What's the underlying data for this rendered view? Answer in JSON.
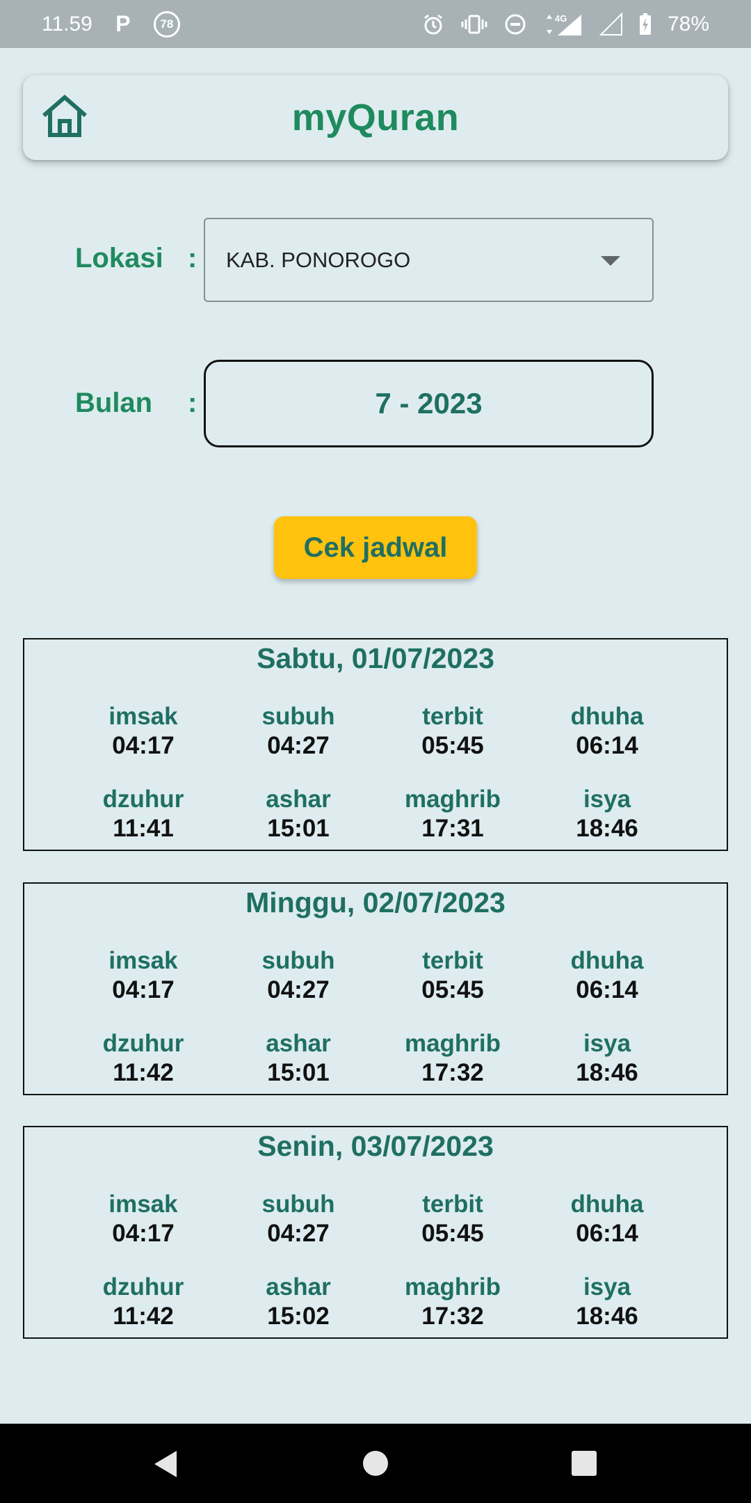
{
  "status_bar": {
    "time": "11.59",
    "notif_p": "P",
    "notif_count": "78",
    "battery": "78%",
    "network": "4G"
  },
  "app": {
    "title": "myQuran"
  },
  "form": {
    "location_label": "Lokasi",
    "colon": ":",
    "location_value": "KAB. PONOROGO",
    "month_label": "Bulan",
    "month_value": "7 - 2023",
    "check_button": "Cek jadwal"
  },
  "schedule": [
    {
      "date": "Sabtu, 01/07/2023",
      "times": [
        {
          "name": "imsak",
          "time": "04:17"
        },
        {
          "name": "subuh",
          "time": "04:27"
        },
        {
          "name": "terbit",
          "time": "05:45"
        },
        {
          "name": "dhuha",
          "time": "06:14"
        },
        {
          "name": "dzuhur",
          "time": "11:41"
        },
        {
          "name": "ashar",
          "time": "15:01"
        },
        {
          "name": "maghrib",
          "time": "17:31"
        },
        {
          "name": "isya",
          "time": "18:46"
        }
      ]
    },
    {
      "date": "Minggu, 02/07/2023",
      "times": [
        {
          "name": "imsak",
          "time": "04:17"
        },
        {
          "name": "subuh",
          "time": "04:27"
        },
        {
          "name": "terbit",
          "time": "05:45"
        },
        {
          "name": "dhuha",
          "time": "06:14"
        },
        {
          "name": "dzuhur",
          "time": "11:42"
        },
        {
          "name": "ashar",
          "time": "15:01"
        },
        {
          "name": "maghrib",
          "time": "17:32"
        },
        {
          "name": "isya",
          "time": "18:46"
        }
      ]
    },
    {
      "date": "Senin, 03/07/2023",
      "times": [
        {
          "name": "imsak",
          "time": "04:17"
        },
        {
          "name": "subuh",
          "time": "04:27"
        },
        {
          "name": "terbit",
          "time": "05:45"
        },
        {
          "name": "dhuha",
          "time": "06:14"
        },
        {
          "name": "dzuhur",
          "time": "11:42"
        },
        {
          "name": "ashar",
          "time": "15:02"
        },
        {
          "name": "maghrib",
          "time": "17:32"
        },
        {
          "name": "isya",
          "time": "18:46"
        }
      ]
    }
  ],
  "colors": {
    "accent_green": "#1f8a5e",
    "dark_teal": "#1f6f62",
    "button_yellow": "#ffc20e",
    "background": "#deecef"
  },
  "icons": {
    "home": "home-icon",
    "dropdown": "chevron-down-icon",
    "nav_back": "back-triangle-icon",
    "nav_home": "home-circle-icon",
    "nav_recents": "recents-square-icon"
  }
}
